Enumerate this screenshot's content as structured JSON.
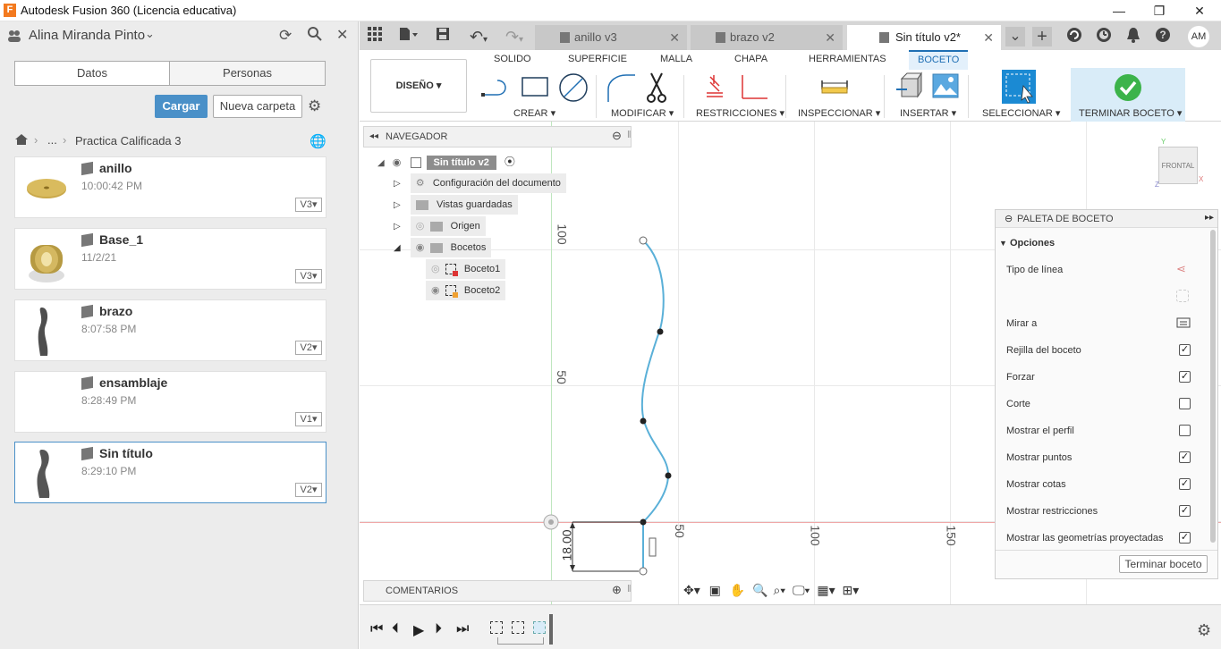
{
  "window": {
    "title": "Autodesk Fusion 360 (Licencia educativa)",
    "logo": "F",
    "minimize": "—",
    "maximize": "❐",
    "close": "✕"
  },
  "user": {
    "name": "Alina Miranda Pinto",
    "initials": "AM"
  },
  "data_panel": {
    "tabs": [
      "Datos",
      "Personas"
    ],
    "upload_label": "Cargar",
    "new_folder_label": "Nueva carpeta",
    "breadcrumb": {
      "ellipsis": "...",
      "folder": "Practica Calificada 3"
    },
    "files": [
      {
        "name": "anillo",
        "time": "10:00:42 PM",
        "version": "V3"
      },
      {
        "name": "Base_1",
        "time": "11/2/21",
        "version": "V3"
      },
      {
        "name": "brazo",
        "time": "8:07:58 PM",
        "version": "V2"
      },
      {
        "name": "ensamblaje",
        "time": "8:28:49 PM",
        "version": "V1"
      },
      {
        "name": "Sin título",
        "time": "8:29:10 PM",
        "version": "V2"
      }
    ]
  },
  "doc_tabs": [
    {
      "label": "anillo v3",
      "active": false
    },
    {
      "label": "brazo v2",
      "active": false
    },
    {
      "label": "Sin título v2*",
      "active": true
    }
  ],
  "ribbon": {
    "workspace": "DISEÑO",
    "tabs": [
      "SOLIDO",
      "SUPERFICIE",
      "MALLA",
      "CHAPA",
      "HERRAMIENTAS",
      "BOCETO"
    ],
    "groups": [
      "CREAR",
      "MODIFICAR",
      "RESTRICCIONES",
      "INSPECCIONAR",
      "INSERTAR",
      "SELECCIONAR",
      "TERMINAR BOCETO"
    ]
  },
  "navigator": {
    "title": "NAVEGADOR",
    "root": "Sin título v2",
    "items": [
      "Configuración del documento",
      "Vistas guardadas",
      "Origen",
      "Bocetos"
    ],
    "sketches": [
      "Boceto1",
      "Boceto2"
    ]
  },
  "comments_label": "COMENTARIOS",
  "viewcube_label": "FRONTAL",
  "axis_labels": {
    "v100": "100",
    "v50": "50",
    "h50": "50",
    "h100": "100",
    "h150": "150",
    "dim": "18.00"
  },
  "palette": {
    "title": "PALETA DE BOCETO",
    "section": "Opciones",
    "rows": [
      {
        "label": "Tipo de línea",
        "type": "icon"
      },
      {
        "label": "",
        "type": "icon"
      },
      {
        "label": "Mirar a",
        "type": "icon"
      },
      {
        "label": "Rejilla del boceto",
        "type": "check",
        "checked": true
      },
      {
        "label": "Forzar",
        "type": "check",
        "checked": true
      },
      {
        "label": "Corte",
        "type": "check",
        "checked": false
      },
      {
        "label": "Mostrar el perfil",
        "type": "check",
        "checked": false
      },
      {
        "label": "Mostrar puntos",
        "type": "check",
        "checked": true
      },
      {
        "label": "Mostrar cotas",
        "type": "check",
        "checked": true
      },
      {
        "label": "Mostrar restricciones",
        "type": "check",
        "checked": true
      },
      {
        "label": "Mostrar las geometrías proyectadas",
        "type": "check",
        "checked": true
      }
    ],
    "finish_label": "Terminar boceto"
  },
  "colors": {
    "accent": "#0696d7",
    "sketch_line": "#5ab0d8",
    "x_axis": "#e26b6b",
    "y_axis": "#8fd18f",
    "finish_green": "#3cb34a"
  }
}
